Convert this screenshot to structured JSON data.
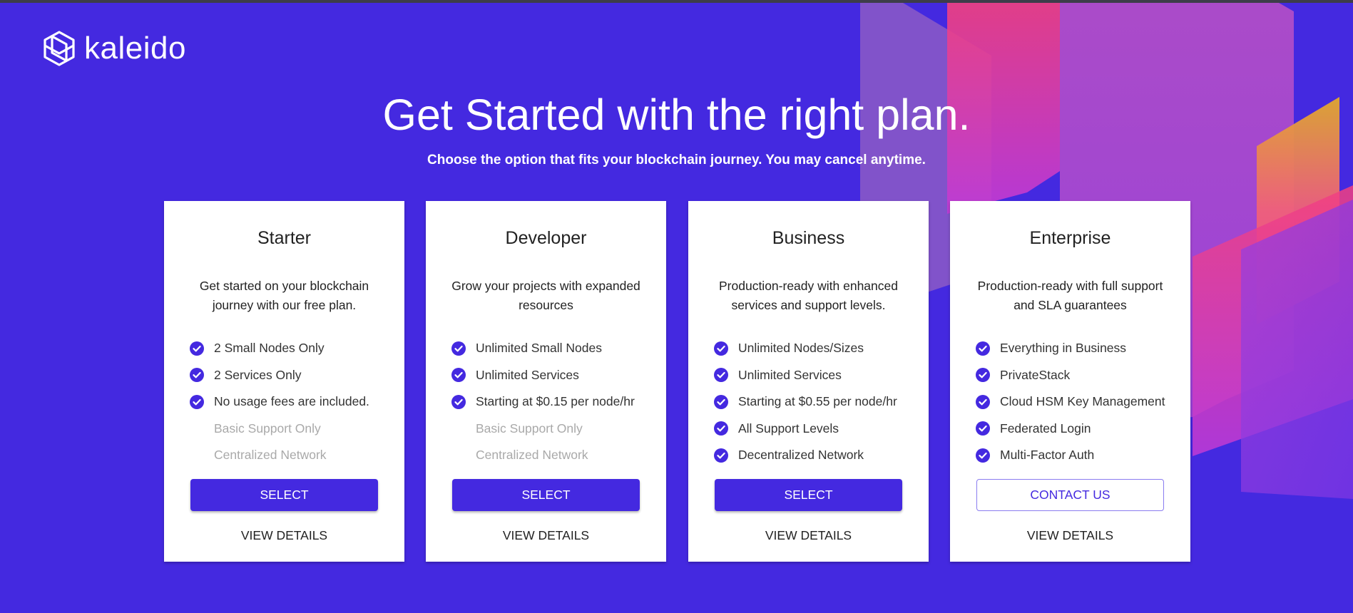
{
  "brand": {
    "logo_text": "kaleido"
  },
  "hero": {
    "title": "Get Started with the right plan.",
    "subtitle": "Choose the option that fits your blockchain journey. You may cancel anytime."
  },
  "colors": {
    "background": "#4429e0",
    "accent": "#4429e0",
    "card": "#ffffff",
    "disabled_text": "#a9a9a9"
  },
  "plans": [
    {
      "name": "Starter",
      "description": "Get started on your blockchain journey with our free plan.",
      "features": [
        {
          "text": "2 Small Nodes Only",
          "included": true,
          "icon": "check-circle-icon"
        },
        {
          "text": "2 Services Only",
          "included": true,
          "icon": "check-circle-icon"
        },
        {
          "text": "No usage fees are included.",
          "included": true,
          "icon": "check-circle-icon"
        },
        {
          "text": "Basic Support Only",
          "included": false
        },
        {
          "text": "Centralized Network",
          "included": false
        }
      ],
      "button_label": "SELECT",
      "details_label": "VIEW DETAILS"
    },
    {
      "name": "Developer",
      "description": "Grow your projects with expanded resources",
      "features": [
        {
          "text": "Unlimited Small Nodes",
          "included": true,
          "icon": "check-circle-icon"
        },
        {
          "text": "Unlimited Services",
          "included": true,
          "icon": "check-circle-icon"
        },
        {
          "text": "Starting at $0.15 per node/hr",
          "included": true,
          "icon": "check-circle-icon"
        },
        {
          "text": "Basic Support Only",
          "included": false
        },
        {
          "text": "Centralized Network",
          "included": false
        }
      ],
      "button_label": "SELECT",
      "details_label": "VIEW DETAILS"
    },
    {
      "name": "Business",
      "description": "Production-ready with enhanced services and support levels.",
      "features": [
        {
          "text": "Unlimited Nodes/Sizes",
          "included": true,
          "icon": "check-circle-icon"
        },
        {
          "text": "Unlimited Services",
          "included": true,
          "icon": "check-circle-icon"
        },
        {
          "text": "Starting at $0.55 per node/hr",
          "included": true,
          "icon": "check-circle-icon"
        },
        {
          "text": "All Support Levels",
          "included": true,
          "icon": "check-circle-icon"
        },
        {
          "text": "Decentralized Network",
          "included": true,
          "icon": "check-circle-icon"
        }
      ],
      "button_label": "SELECT",
      "details_label": "VIEW DETAILS"
    },
    {
      "name": "Enterprise",
      "description": "Production-ready with full support and SLA guarantees",
      "features": [
        {
          "text": "Everything in Business",
          "included": true,
          "icon": "check-circle-icon"
        },
        {
          "text": "PrivateStack",
          "included": true,
          "icon": "check-circle-icon"
        },
        {
          "text": "Cloud HSM Key Management",
          "included": true,
          "icon": "check-circle-icon"
        },
        {
          "text": "Federated Login",
          "included": true,
          "icon": "check-circle-icon"
        },
        {
          "text": "Multi-Factor Auth",
          "included": true,
          "icon": "check-circle-icon"
        }
      ],
      "button_label": "CONTACT US",
      "details_label": "VIEW DETAILS"
    }
  ]
}
